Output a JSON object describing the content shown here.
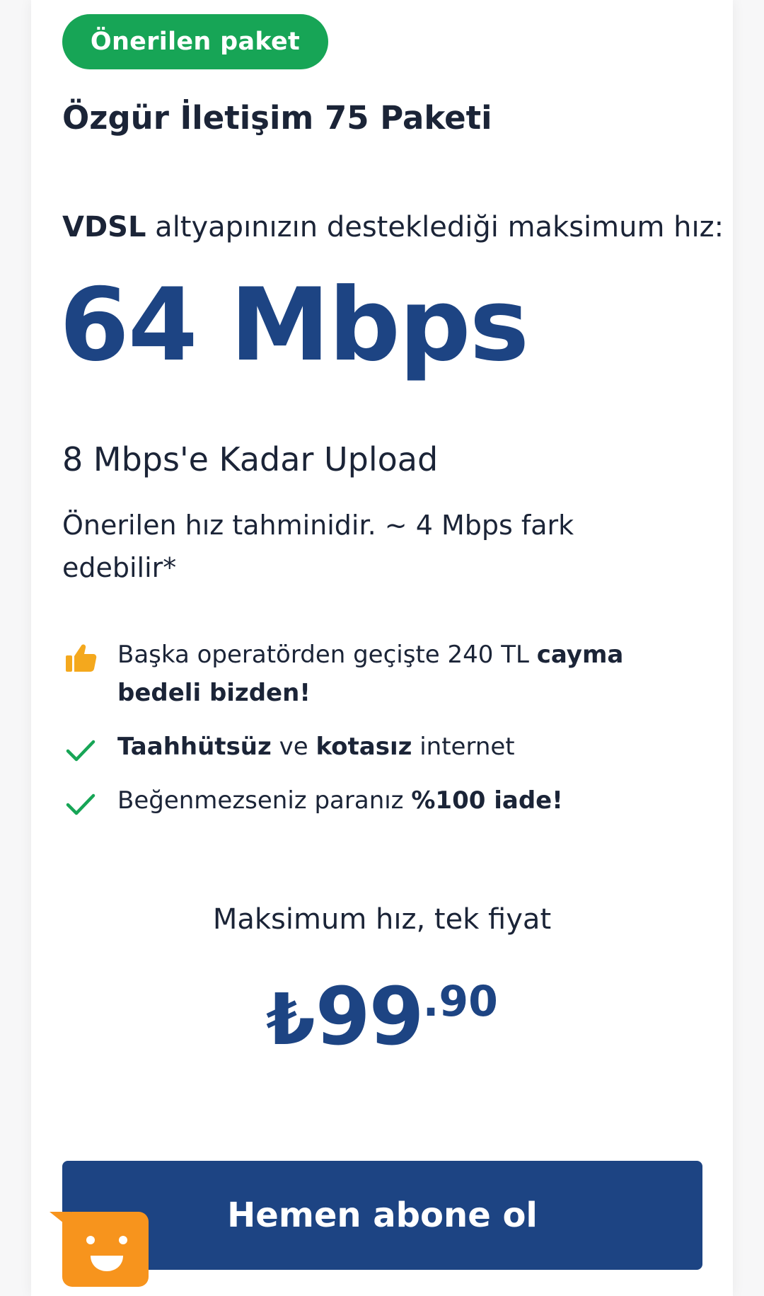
{
  "badge": {
    "label": "Önerilen paket"
  },
  "package": {
    "title": "Özgür İletişim 75 Paketi"
  },
  "infrastructure": {
    "type": "VDSL",
    "text": " altyapınızın desteklediği maksimum hız:"
  },
  "speed": {
    "value": "64 Mbps"
  },
  "upload": {
    "text": "8 Mbps'e Kadar Upload"
  },
  "note": {
    "text": "Önerilen hız tahminidir. ~ 4 Mbps fark edebilir*"
  },
  "features": [
    {
      "icon": "thumbs-up-icon",
      "text_prefix": "Başka operatörden geçişte 240 TL ",
      "bold": "cayma bedeli bizden!"
    },
    {
      "icon": "check-icon",
      "bold_1": "Taahhütsüz",
      "text_1": " ve ",
      "bold_2": "kotasız",
      "text_2": " internet"
    },
    {
      "icon": "check-icon",
      "text_prefix": "Beğenmezseniz paranız ",
      "bold": "%100 iade!"
    }
  ],
  "pricing": {
    "caption": "Maksimum hız, tek fiyat",
    "currency": "₺",
    "amount": "99",
    "decimals": ".90"
  },
  "cta": {
    "label": "Hemen abone ol"
  },
  "colors": {
    "brand_blue": "#1d4483",
    "badge_green": "#17a556",
    "check_green": "#17a556",
    "thumb_orange": "#f4a81d",
    "chat_orange": "#f7941d",
    "text_dark": "#1b2437"
  },
  "chat_widget": {
    "icon": "chat-smiley-icon"
  }
}
